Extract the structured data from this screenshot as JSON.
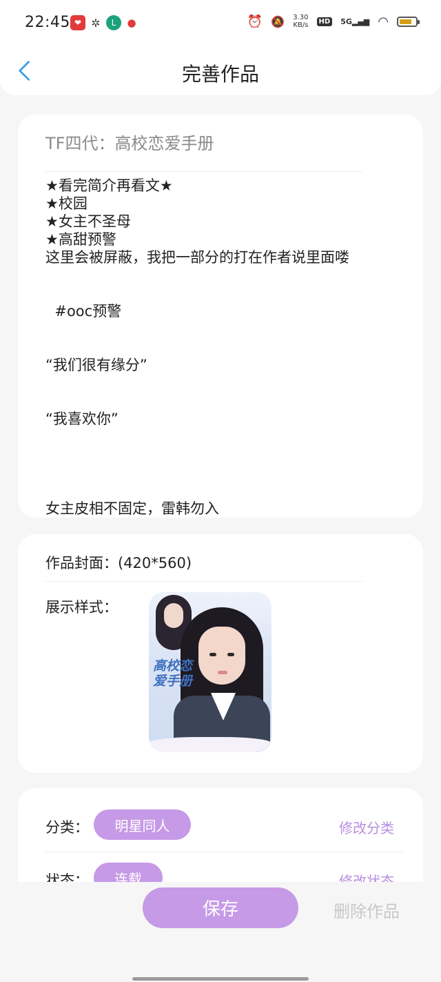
{
  "status_bar": {
    "time": "22:45",
    "network_speed": "3.30",
    "network_speed_unit": "KB/s",
    "hd_label": "HD",
    "signal_label": "5G",
    "icons": [
      "alarm-icon",
      "mute-icon",
      "wifi-icon",
      "battery-icon"
    ]
  },
  "header": {
    "title": "完善作品"
  },
  "work": {
    "title": "TF四代：高校恋爱手册",
    "intro_lines": [
      "★看完简介再看文★",
      "★校园",
      "★女主不圣母",
      "★高甜预警",
      "这里会被屏蔽，我把一部分的打在作者说里面喽",
      "",
      "",
      "  #ooc预警",
      "",
      "",
      "“我们很有缘分”",
      "",
      "",
      "“我喜欢你”",
      "",
      "",
      "",
      "",
      "女主皮相不固定，雷韩勿入"
    ]
  },
  "cover": {
    "label": "作品封面：(420*560)",
    "style_label": "展示样式：",
    "cover_text": "高校恋爱手册"
  },
  "meta": {
    "category_label": "分类：",
    "category_value": "明星同人",
    "category_link": "修改分类",
    "status_label": "状态：",
    "status_value": "连载",
    "status_link": "修改状态"
  },
  "actions": {
    "save": "保存",
    "delete": "删除作品"
  },
  "colors": {
    "accent": "#c69ae6",
    "link": "#b78ee0",
    "back": "#3aa0e6",
    "background": "#f6f6f6"
  }
}
